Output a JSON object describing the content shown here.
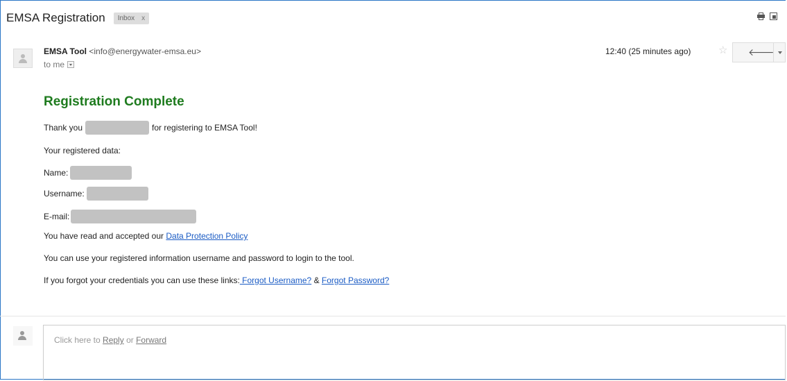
{
  "email": {
    "subject": "EMSA Registration",
    "label": "Inbox",
    "label_remove": "x",
    "sender_name": "EMSA Tool",
    "sender_email": "<info@energywater-emsa.eu>",
    "to_text": "to me",
    "time": "12:40 (25 minutes ago)"
  },
  "icons": {
    "print": "printer-icon",
    "new_window": "new-window-icon",
    "star": "star-icon",
    "reply": "reply-arrow-icon",
    "more": "chevron-down-icon"
  },
  "body": {
    "title": "Registration Complete",
    "thank_you_pre": "Thank you",
    "thank_you_post": "for registering to EMSA Tool!",
    "registered_data": "Your registered data:",
    "name_label": "Name:",
    "username_label": "Username:",
    "email_label": "E-mail:",
    "accepted_pre": "You have read and accepted our",
    "policy_link": "Data Protection Policy",
    "login_info": "You can use your registered information username and password to login to the tool.",
    "forgot_pre": "If you forgot your credentials you can use these links:",
    "forgot_username": " Forgot Username?",
    "amp": "&",
    "forgot_password": "Forgot Password?"
  },
  "reply": {
    "prefix": "Click here to",
    "reply_link": "Reply",
    "or": "or",
    "forward_link": "Forward"
  },
  "colors": {
    "title_green": "#1e7b1e",
    "link_blue": "#1a5bc4",
    "frame_blue": "#2a76c6",
    "redaction_gray": "#c2c2c2"
  }
}
